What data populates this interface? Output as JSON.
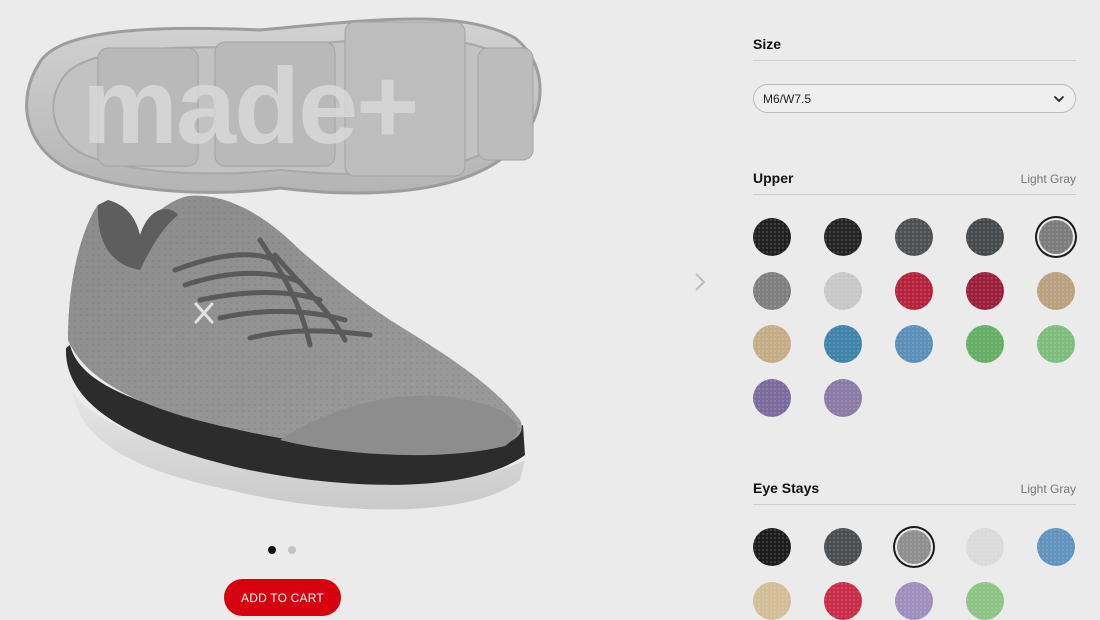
{
  "product": {
    "sole_logo_text": "made+",
    "add_to_cart_label": "ADD TO CART",
    "gallery": {
      "total": 2,
      "active": 1
    }
  },
  "size": {
    "title": "Size",
    "selected": "M6/W7.5"
  },
  "upper": {
    "title": "Upper",
    "selected_name": "Light Gray",
    "swatches": [
      {
        "color": "#1f1f1f"
      },
      {
        "color": "#232323"
      },
      {
        "color": "#4d4f51"
      },
      {
        "color": "#45484b"
      },
      {
        "color": "#7b7b7b",
        "selected": true
      },
      {
        "color": "#7e7e7e"
      },
      {
        "color": "#c7c7c7"
      },
      {
        "color": "#b5213a"
      },
      {
        "color": "#9a1d39"
      },
      {
        "color": "#b9a07e"
      },
      {
        "color": "#c4ac86"
      },
      {
        "color": "#3f82aa"
      },
      {
        "color": "#5a8fb9"
      },
      {
        "color": "#64ad64"
      },
      {
        "color": "#7cbc7b"
      },
      {
        "color": "#7b6a9c"
      },
      {
        "color": "#8a7aa6"
      }
    ]
  },
  "eye_stays": {
    "title": "Eye Stays",
    "selected_name": "Light Gray",
    "swatches": [
      {
        "color": "#1c1c1c"
      },
      {
        "color": "#4a4d4f"
      },
      {
        "color": "#8e8e8e",
        "selected": true
      },
      {
        "color": "#dadada"
      },
      {
        "color": "#5f93bd"
      },
      {
        "color": "#d2bd97"
      },
      {
        "color": "#c82a47"
      },
      {
        "color": "#9d8ebd"
      },
      {
        "color": "#8cc484"
      }
    ]
  }
}
